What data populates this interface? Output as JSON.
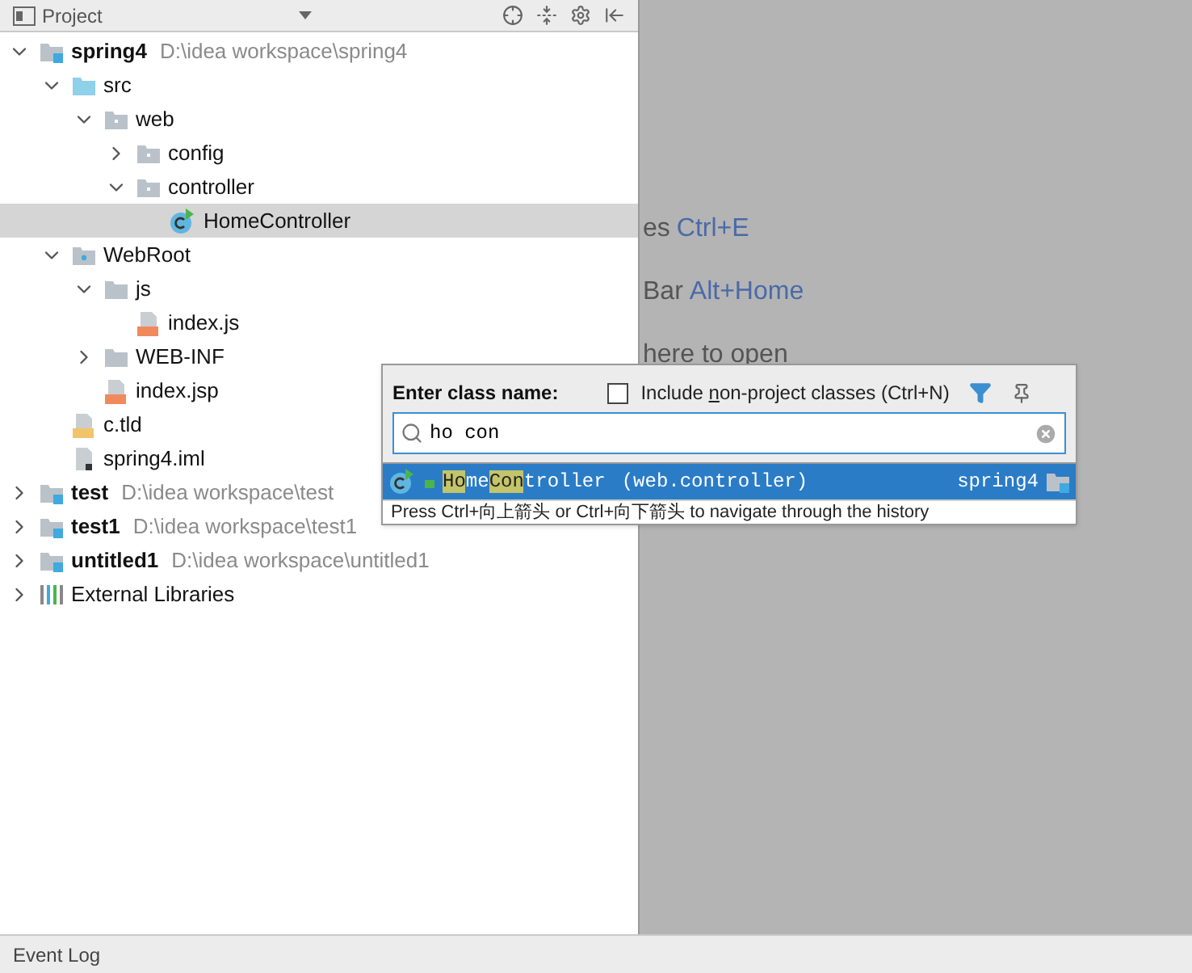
{
  "panel": {
    "title": "Project"
  },
  "tree": [
    {
      "label": "spring4",
      "kind": "module",
      "path": "D:\\idea workspace\\spring4",
      "expanded": true,
      "selected": false,
      "children": [
        {
          "label": "src",
          "kind": "source-folder",
          "expanded": true,
          "selected": false,
          "children": [
            {
              "label": "web",
              "kind": "package",
              "expanded": true,
              "selected": false,
              "children": [
                {
                  "label": "config",
                  "kind": "package",
                  "expanded": false,
                  "selected": false
                },
                {
                  "label": "controller",
                  "kind": "package",
                  "expanded": true,
                  "selected": false,
                  "children": [
                    {
                      "label": "HomeController",
                      "kind": "class",
                      "selected": true
                    }
                  ]
                }
              ]
            }
          ]
        },
        {
          "label": "WebRoot",
          "kind": "web-folder",
          "expanded": true,
          "selected": false,
          "children": [
            {
              "label": "js",
              "kind": "folder",
              "expanded": true,
              "selected": false,
              "children": [
                {
                  "label": "index.js",
                  "kind": "js",
                  "selected": false
                }
              ]
            },
            {
              "label": "WEB-INF",
              "kind": "folder",
              "expanded": false,
              "selected": false
            },
            {
              "label": "index.jsp",
              "kind": "jsp",
              "selected": false
            }
          ]
        },
        {
          "label": "c.tld",
          "kind": "tld",
          "selected": false
        },
        {
          "label": "spring4.iml",
          "kind": "iml",
          "selected": false
        }
      ]
    },
    {
      "label": "test",
      "kind": "module",
      "path": "D:\\idea workspace\\test",
      "expanded": false,
      "selected": false
    },
    {
      "label": "test1",
      "kind": "module",
      "path": "D:\\idea workspace\\test1",
      "expanded": false,
      "selected": false
    },
    {
      "label": "untitled1",
      "kind": "module",
      "path": "D:\\idea workspace\\untitled1",
      "expanded": false,
      "selected": false
    },
    {
      "label": "External Libraries",
      "kind": "libraries",
      "expanded": false,
      "selected": false
    }
  ],
  "hints": [
    {
      "text": "es",
      "shortcut": "Ctrl+E"
    },
    {
      "text": "Bar",
      "shortcut": "Alt+Home"
    },
    {
      "text": "here to open"
    }
  ],
  "popup": {
    "title": "Enter class name:",
    "checkbox": {
      "label_before": "Include ",
      "mnemonic": "n",
      "label_after": "on-project classes (Ctrl+N)",
      "checked": false
    },
    "search": {
      "value": "ho con"
    },
    "results": [
      {
        "segments": [
          {
            "text": "Ho",
            "match": true
          },
          {
            "text": "me",
            "match": false
          },
          {
            "text": "Con",
            "match": true
          },
          {
            "text": "troller",
            "match": false
          }
        ],
        "package": "(web.controller)",
        "module": "spring4",
        "selected": true
      }
    ],
    "footer": "Press Ctrl+向上箭头 or Ctrl+向下箭头 to navigate through the history"
  },
  "status_bar": {
    "label": "Event Log"
  }
}
